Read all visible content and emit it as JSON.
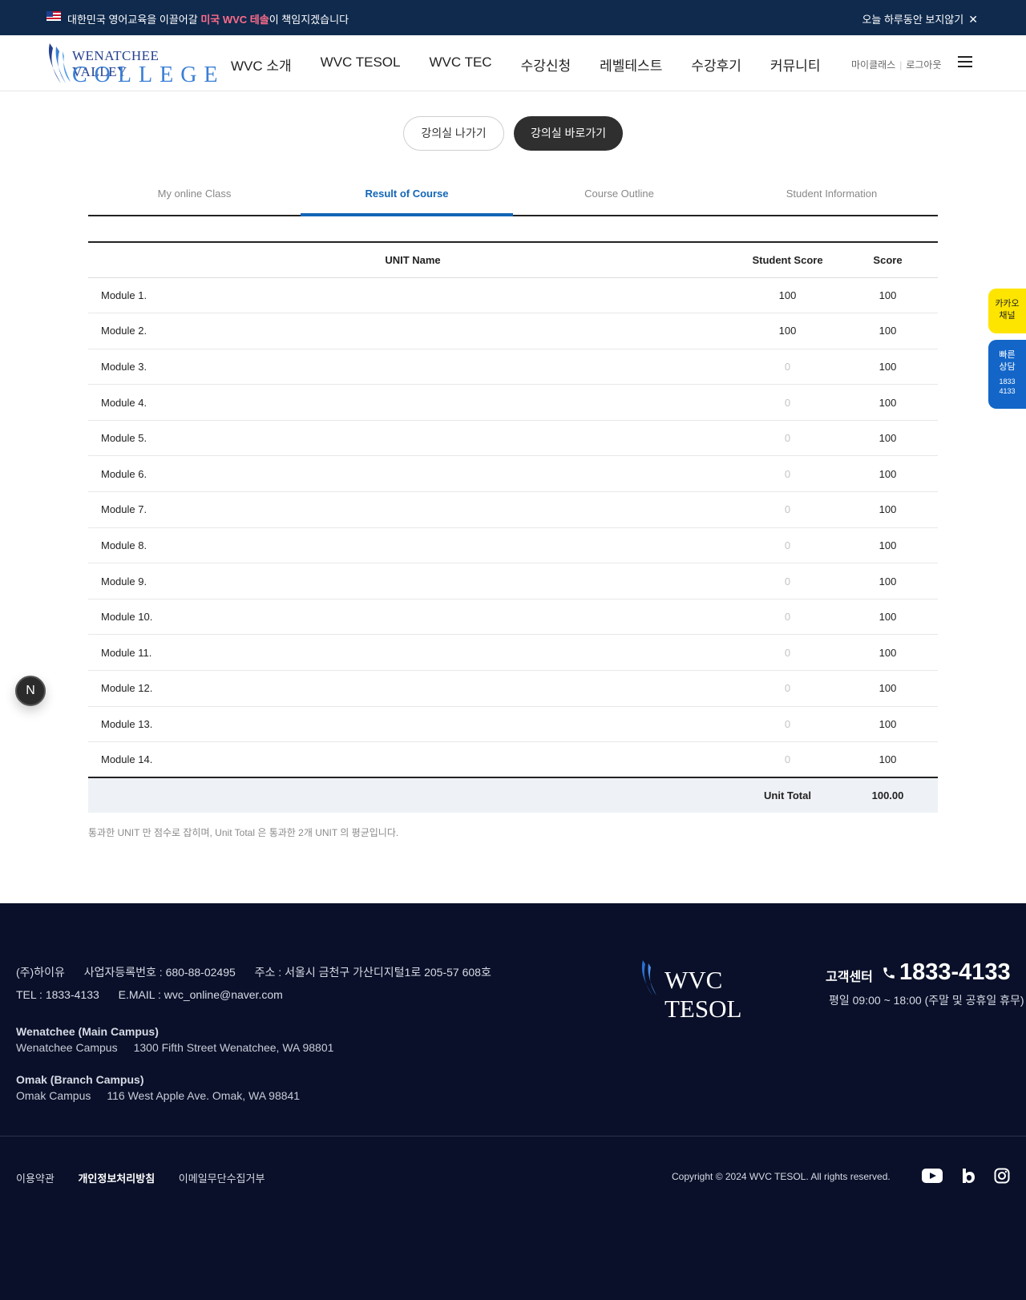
{
  "topbar": {
    "message_pre": "대한민국 영어교육을 이끌어갈 ",
    "message_highlight": "미국 WVC 테솔",
    "message_post": "이 책임지겠습니다",
    "dismiss_label": "오늘 하루동안 보지않기",
    "close_glyph": "✕"
  },
  "header": {
    "logo_line1": "WENATCHEE VALLEY",
    "logo_line2": "COLLEGE",
    "nav": [
      "WVC 소개",
      "WVC TESOL",
      "WVC TEC",
      "수강신청",
      "레벨테스트",
      "수강후기",
      "커뮤니티"
    ],
    "util_myclass": "마이클래스",
    "util_logout": "로그아웃"
  },
  "classroom": {
    "exit_label": "강의실 나가기",
    "go_label": "강의실 바로가기"
  },
  "tabs": [
    "My online Class",
    "Result of Course",
    "Course Outline",
    "Student Information"
  ],
  "active_tab": "Result of Course",
  "table": {
    "headers": {
      "name": "UNIT Name",
      "student_score": "Student Score",
      "score": "Score"
    },
    "rows": [
      {
        "name": "Module 1.",
        "student_score": "100",
        "score": "100"
      },
      {
        "name": "Module 2.",
        "student_score": "100",
        "score": "100"
      },
      {
        "name": "Module 3.",
        "student_score": "0",
        "score": "100"
      },
      {
        "name": "Module 4.",
        "student_score": "0",
        "score": "100"
      },
      {
        "name": "Module 5.",
        "student_score": "0",
        "score": "100"
      },
      {
        "name": "Module 6.",
        "student_score": "0",
        "score": "100"
      },
      {
        "name": "Module 7.",
        "student_score": "0",
        "score": "100"
      },
      {
        "name": "Module 8.",
        "student_score": "0",
        "score": "100"
      },
      {
        "name": "Module 9.",
        "student_score": "0",
        "score": "100"
      },
      {
        "name": "Module 10.",
        "student_score": "0",
        "score": "100"
      },
      {
        "name": "Module 11.",
        "student_score": "0",
        "score": "100"
      },
      {
        "name": "Module 12.",
        "student_score": "0",
        "score": "100"
      },
      {
        "name": "Module 13.",
        "student_score": "0",
        "score": "100"
      },
      {
        "name": "Module 14.",
        "student_score": "0",
        "score": "100"
      }
    ],
    "total_label": "Unit Total",
    "total_value": "100.00"
  },
  "note": "통과한 UNIT 만 점수로 잡히며, Unit Total 은 통과한 2개 UNIT 의 평균입니다.",
  "side": {
    "kakao_line1": "카카오",
    "kakao_line2": "채널",
    "quick_line1": "빠른",
    "quick_line2": "상담",
    "quick_num1": "1833",
    "quick_num2": "4133",
    "n_badge": "N"
  },
  "footer": {
    "company": "(주)하이유",
    "biz_no": "사업자등록번호 : 680-88-02495",
    "address": "주소 : 서울시 금천구 가산디지털1로 205-57 608호",
    "tel": "TEL : 1833-4133",
    "email": "E.MAIL : wvc_online@naver.com",
    "main_campus_title": "Wenatchee (Main Campus)",
    "main_campus_name": "Wenatchee Campus",
    "main_campus_addr": "1300 Fifth Street Wenatchee, WA 98801",
    "branch_campus_title": "Omak (Branch Campus)",
    "branch_campus_name": "Omak Campus",
    "branch_campus_addr": "116 West Apple Ave. Omak, WA 98841",
    "logo_text": "WVC TESOL",
    "cs_label": "고객센터",
    "cs_number": "1833-4133",
    "cs_hours": "평일 09:00 ~ 18:00 (주말 및 공휴일 휴무)",
    "links": [
      "이용약관",
      "개인정보처리방침",
      "이메일무단수집거부"
    ],
    "copyright": "Copyright © 2024 WVC TESOL. All rights reserved.",
    "sns_icons": [
      "youtube-icon",
      "blog-icon",
      "instagram-icon"
    ]
  },
  "colors": {
    "topbar_bg": "#0f2a4d",
    "accent_blue": "#1366b8",
    "highlight_pink": "#ff6b8a",
    "kakao_yellow": "#fee500",
    "footer_bg": "#0a1029"
  }
}
